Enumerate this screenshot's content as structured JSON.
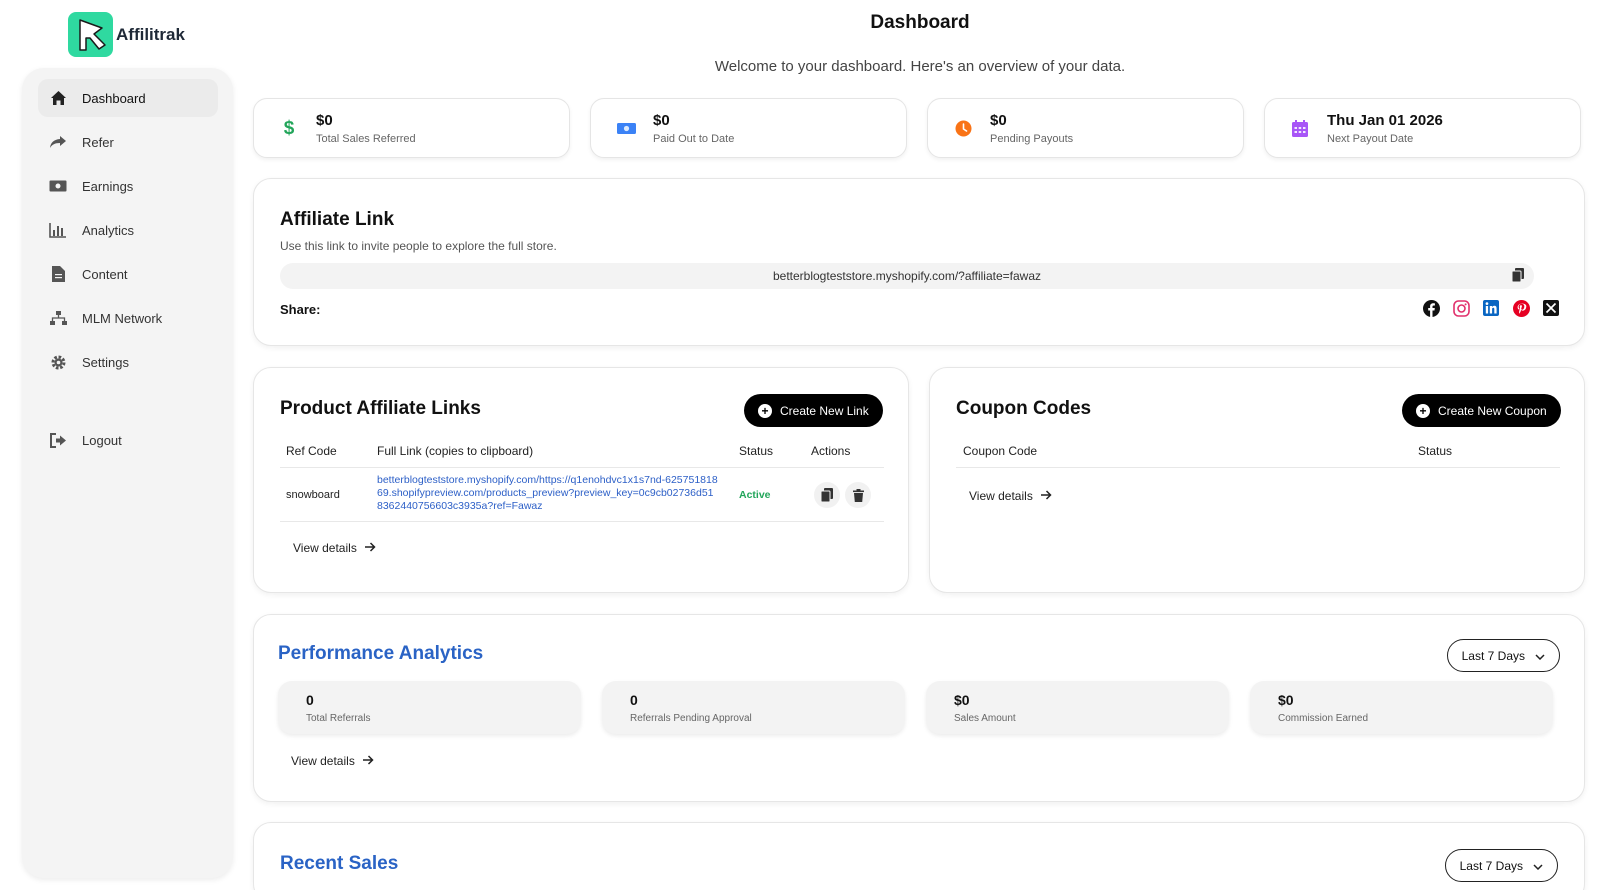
{
  "brand": {
    "name": "Affilitrak",
    "accent": "#2fd9a0"
  },
  "sidebar": {
    "items": [
      {
        "label": "Dashboard",
        "icon": "home-icon",
        "active": true
      },
      {
        "label": "Refer",
        "icon": "share-arrow-icon"
      },
      {
        "label": "Earnings",
        "icon": "money-icon"
      },
      {
        "label": "Analytics",
        "icon": "bar-chart-icon"
      },
      {
        "label": "Content",
        "icon": "document-icon"
      },
      {
        "label": "MLM Network",
        "icon": "network-icon"
      },
      {
        "label": "Settings",
        "icon": "gear-icon"
      }
    ],
    "logout": {
      "label": "Logout",
      "icon": "logout-icon"
    }
  },
  "header": {
    "title": "Dashboard",
    "subtitle": "Welcome to your dashboard. Here's an overview of your data."
  },
  "stats": [
    {
      "value": "$0",
      "label": "Total Sales Referred",
      "icon": "dollar-icon",
      "color": "#22a55a"
    },
    {
      "value": "$0",
      "label": "Paid Out to Date",
      "icon": "cash-icon",
      "color": "#3b82f6"
    },
    {
      "value": "$0",
      "label": "Pending Payouts",
      "icon": "clock-icon",
      "color": "#f97316"
    },
    {
      "value": "Thu Jan 01 2026",
      "label": "Next Payout Date",
      "icon": "calendar-icon",
      "color": "#a855f7"
    }
  ],
  "affiliate_link": {
    "title": "Affiliate Link",
    "description": "Use this link to invite people to explore the full store.",
    "url": "betterblogteststore.myshopify.com/?affiliate=fawaz",
    "share_label": "Share:",
    "share_icons": [
      "facebook-icon",
      "instagram-icon",
      "linkedin-icon",
      "pinterest-icon",
      "x-icon"
    ]
  },
  "product_links": {
    "title": "Product Affiliate Links",
    "create_button": "Create New Link",
    "headers": [
      "Ref Code",
      "Full Link (copies to clipboard)",
      "Status",
      "Actions"
    ],
    "rows": [
      {
        "ref_code": "snowboard",
        "link": "betterblogteststore.myshopify.com/https://q1enohdvc1x1s7nd-62575181869.shopifypreview.com/products_preview?preview_key=0c9cb02736d518362440756603c3935a?ref=Fawaz",
        "status": "Active"
      }
    ],
    "view_details": "View details"
  },
  "coupon_codes": {
    "title": "Coupon Codes",
    "create_button": "Create New Coupon",
    "headers": [
      "Coupon Code",
      "Status"
    ],
    "view_details": "View details"
  },
  "performance": {
    "title": "Performance Analytics",
    "range": "Last 7 Days",
    "metrics": [
      {
        "value": "0",
        "label": "Total Referrals"
      },
      {
        "value": "0",
        "label": "Referrals Pending Approval"
      },
      {
        "value": "$0",
        "label": "Sales Amount"
      },
      {
        "value": "$0",
        "label": "Commission Earned"
      }
    ],
    "view_details": "View details"
  },
  "recent_sales": {
    "title": "Recent Sales",
    "range": "Last 7 Days"
  }
}
